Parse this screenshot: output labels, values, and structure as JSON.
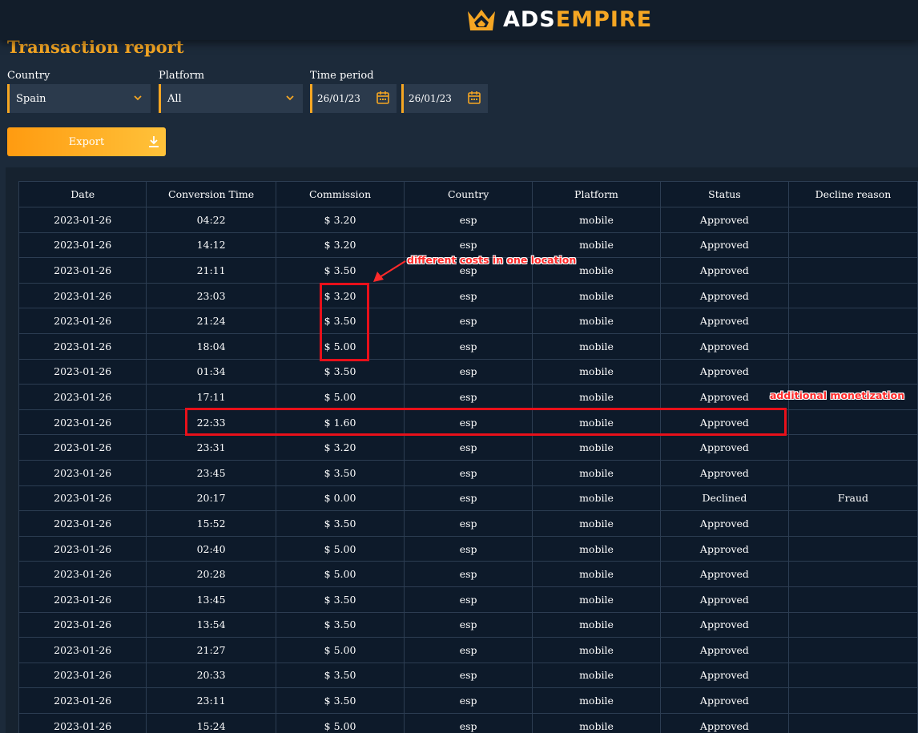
{
  "brand": {
    "part1": "ADS",
    "part2": "EMPIRE",
    "accent_color": "#f5a623"
  },
  "page": {
    "title": "Transaction report"
  },
  "filters": {
    "country": {
      "label": "Country",
      "value": "Spain"
    },
    "platform": {
      "label": "Platform",
      "value": "All"
    },
    "time_period": {
      "label": "Time period",
      "from": "26/01/23",
      "to": "26/01/23"
    }
  },
  "export": {
    "label": "Export",
    "icon": "download-icon"
  },
  "table": {
    "columns": [
      "Date",
      "Conversion Time",
      "Commission",
      "Country",
      "Platform",
      "Status",
      "Decline reason"
    ],
    "rows": [
      [
        "2023-01-26",
        "04:22",
        "$ 3.20",
        "esp",
        "mobile",
        "Approved",
        ""
      ],
      [
        "2023-01-26",
        "14:12",
        "$ 3.20",
        "esp",
        "mobile",
        "Approved",
        ""
      ],
      [
        "2023-01-26",
        "21:11",
        "$ 3.50",
        "esp",
        "mobile",
        "Approved",
        ""
      ],
      [
        "2023-01-26",
        "23:03",
        "$ 3.20",
        "esp",
        "mobile",
        "Approved",
        ""
      ],
      [
        "2023-01-26",
        "21:24",
        "$ 3.50",
        "esp",
        "mobile",
        "Approved",
        ""
      ],
      [
        "2023-01-26",
        "18:04",
        "$ 5.00",
        "esp",
        "mobile",
        "Approved",
        ""
      ],
      [
        "2023-01-26",
        "01:34",
        "$ 3.50",
        "esp",
        "mobile",
        "Approved",
        ""
      ],
      [
        "2023-01-26",
        "17:11",
        "$ 5.00",
        "esp",
        "mobile",
        "Approved",
        ""
      ],
      [
        "2023-01-26",
        "22:33",
        "$ 1.60",
        "esp",
        "mobile",
        "Approved",
        ""
      ],
      [
        "2023-01-26",
        "23:31",
        "$ 3.20",
        "esp",
        "mobile",
        "Approved",
        ""
      ],
      [
        "2023-01-26",
        "23:45",
        "$ 3.50",
        "esp",
        "mobile",
        "Approved",
        ""
      ],
      [
        "2023-01-26",
        "20:17",
        "$ 0.00",
        "esp",
        "mobile",
        "Declined",
        "Fraud"
      ],
      [
        "2023-01-26",
        "15:52",
        "$ 3.50",
        "esp",
        "mobile",
        "Approved",
        ""
      ],
      [
        "2023-01-26",
        "02:40",
        "$ 5.00",
        "esp",
        "mobile",
        "Approved",
        ""
      ],
      [
        "2023-01-26",
        "20:28",
        "$ 5.00",
        "esp",
        "mobile",
        "Approved",
        ""
      ],
      [
        "2023-01-26",
        "13:45",
        "$ 3.50",
        "esp",
        "mobile",
        "Approved",
        ""
      ],
      [
        "2023-01-26",
        "13:54",
        "$ 3.50",
        "esp",
        "mobile",
        "Approved",
        ""
      ],
      [
        "2023-01-26",
        "21:27",
        "$ 5.00",
        "esp",
        "mobile",
        "Approved",
        ""
      ],
      [
        "2023-01-26",
        "20:33",
        "$ 3.50",
        "esp",
        "mobile",
        "Approved",
        ""
      ],
      [
        "2023-01-26",
        "23:11",
        "$ 3.50",
        "esp",
        "mobile",
        "Approved",
        ""
      ],
      [
        "2023-01-26",
        "15:24",
        "$ 5.00",
        "esp",
        "mobile",
        "Approved",
        ""
      ]
    ]
  },
  "annotations": {
    "costs_note": "different costs in one location",
    "monetization_note": "additional monetization",
    "color": "#e8101a"
  }
}
